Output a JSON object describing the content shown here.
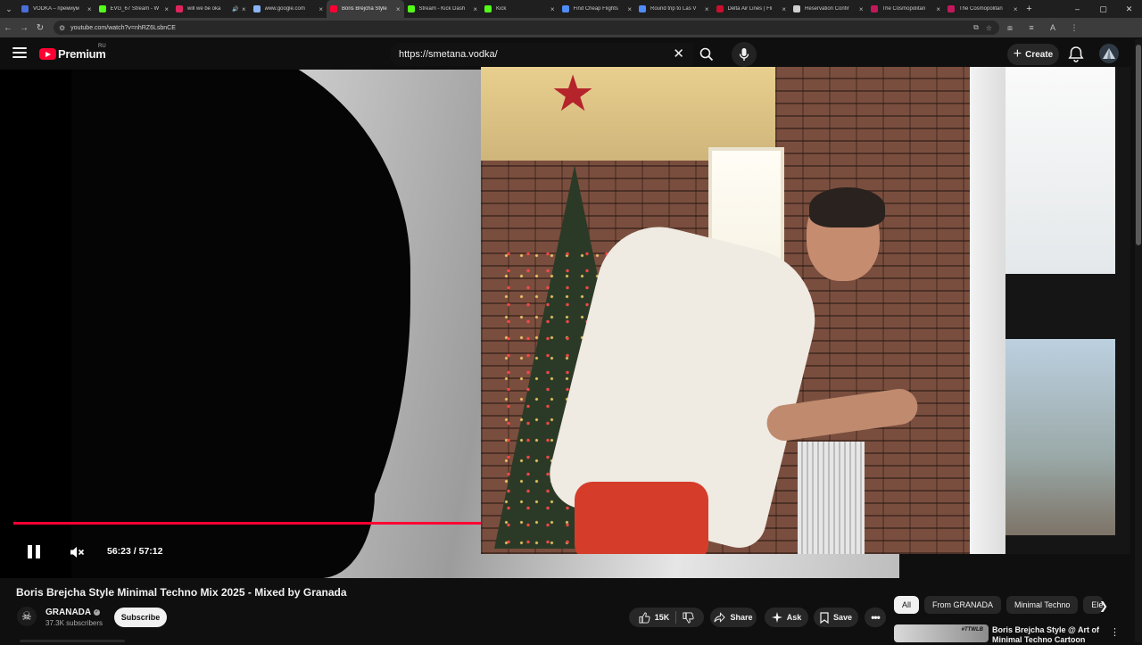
{
  "browser": {
    "tabs": [
      {
        "title": "VODKA – премиум",
        "favicon_color": "#4a6fd8"
      },
      {
        "title": "EVG_67 Stream - W",
        "favicon_color": "#53fc18"
      },
      {
        "title": "will we be oka",
        "favicon_color": "#e0245e"
      },
      {
        "title": "www.google.com",
        "favicon_color": "#8ab4f8"
      },
      {
        "title": "Boris Brejcha Style",
        "favicon_color": "#ff0033",
        "active": true
      },
      {
        "title": "Stream - Kick Dash",
        "favicon_color": "#53fc18"
      },
      {
        "title": "Kick",
        "favicon_color": "#53fc18"
      },
      {
        "title": "Find Cheap Flights",
        "favicon_color": "#4f8cf7"
      },
      {
        "title": "Round trip to Las V",
        "favicon_color": "#4f8cf7"
      },
      {
        "title": "Delta Air Lines | Fli",
        "favicon_color": "#c8102e"
      },
      {
        "title": "Reservation Confir",
        "favicon_color": "#cfcfcf"
      },
      {
        "title": "The Cosmopolitan",
        "favicon_color": "#c2185b"
      },
      {
        "title": "The Cosmopolitan",
        "favicon_color": "#c2185b"
      }
    ],
    "address": "youtube.com/watch?v=nhRZ6LsbnCE"
  },
  "masthead": {
    "logo_text": "Premium",
    "country_code": "RU",
    "search_value": "https://smetana.vodka/",
    "create_label": "Create"
  },
  "player": {
    "time": "56:23 / 57:12",
    "progress": 0.5477
  },
  "video": {
    "title": "Boris Brejcha Style Minimal Techno Mix 2025 - Mixed by Granada",
    "channel": "GRANADA",
    "subscribers": "37.3K subscribers",
    "subscribe_label": "Subscribe",
    "likes": "15K",
    "share_label": "Share",
    "ask_label": "Ask",
    "save_label": "Save"
  },
  "chips": [
    "All",
    "From GRANADA",
    "Minimal Techno",
    "Ele"
  ],
  "recommendation": {
    "title": "Boris Brejcha Style @ Art of Minimal Techno Cartoon",
    "thumb_text": "#TTWLB"
  },
  "colors": {
    "accent": "#ff0033",
    "background": "#0f0f0f"
  }
}
